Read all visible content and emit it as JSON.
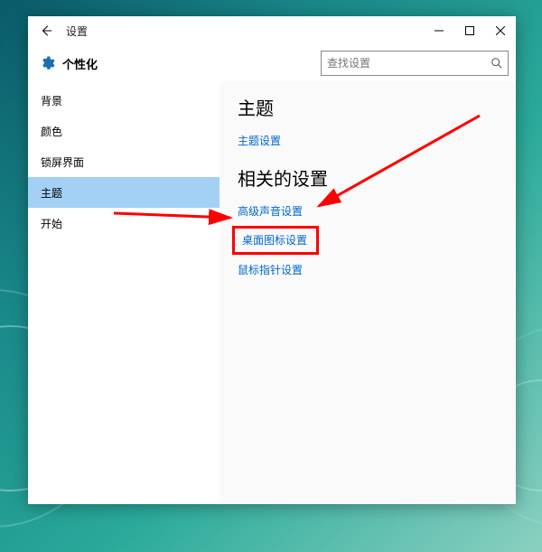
{
  "titlebar": {
    "title": "设置"
  },
  "header": {
    "page_title": "个性化"
  },
  "search": {
    "placeholder": "查找设置"
  },
  "sidebar": {
    "items": [
      {
        "label": "背景",
        "selected": false
      },
      {
        "label": "颜色",
        "selected": false
      },
      {
        "label": "锁屏界面",
        "selected": false
      },
      {
        "label": "主题",
        "selected": true
      },
      {
        "label": "开始",
        "selected": false
      }
    ]
  },
  "content": {
    "section1_heading": "主题",
    "link_theme_settings": "主题设置",
    "section2_heading": "相关的设置",
    "link_sound": "高级声音设置",
    "link_desktop_icons": "桌面图标设置",
    "link_mouse_pointer": "鼠标指针设置"
  },
  "annotation": {
    "highlight_color": "#ff0000"
  }
}
